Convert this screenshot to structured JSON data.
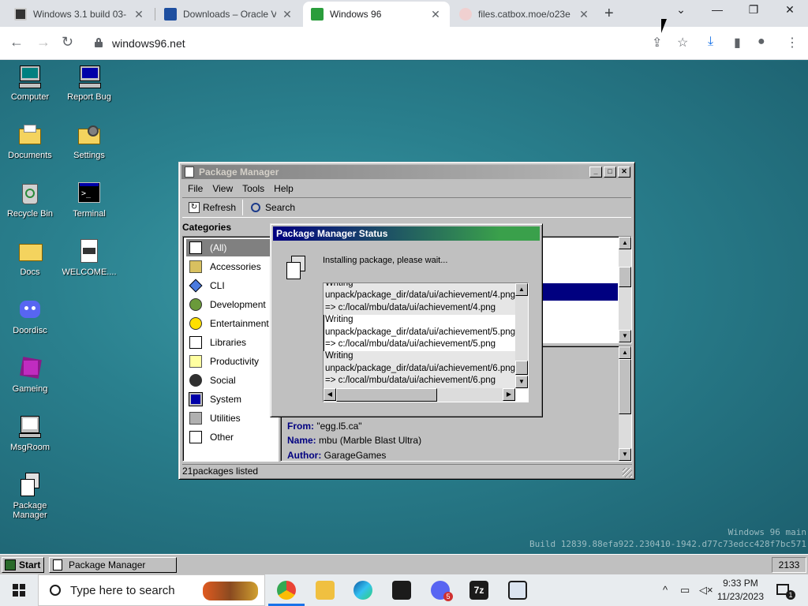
{
  "browser": {
    "tabs": [
      {
        "title": "Windows 3.1 build 03-",
        "active": false
      },
      {
        "title": "Downloads – Oracle V",
        "active": false
      },
      {
        "title": "Windows 96",
        "active": true
      },
      {
        "title": "files.catbox.moe/o23e",
        "active": false
      }
    ],
    "new_tab": "+",
    "url": "windows96.net"
  },
  "desktop": {
    "icons": [
      {
        "label": "Computer"
      },
      {
        "label": "Report Bug"
      },
      {
        "label": "Documents"
      },
      {
        "label": "Settings"
      },
      {
        "label": "Recycle Bin"
      },
      {
        "label": "Terminal"
      },
      {
        "label": "Docs"
      },
      {
        "label": "WELCOME...."
      },
      {
        "label": "Doordisc"
      },
      {
        "label": "Gameing"
      },
      {
        "label": "MsgRoom"
      },
      {
        "label": "Package Manager"
      }
    ],
    "watermark_line1": "Windows 96 main",
    "watermark_line2": "Build 12839.88efa922.230410-1942.d77c73edcc428f7bc571"
  },
  "package_manager": {
    "title": "Package Manager",
    "menu": [
      "File",
      "View",
      "Tools",
      "Help"
    ],
    "toolbar": {
      "refresh": "Refresh",
      "search": "Search"
    },
    "categories_heading": "Categories",
    "categories": [
      "(All)",
      "Accessories",
      "CLI",
      "Development",
      "Entertainment",
      "Libraries",
      "Productivity",
      "Social",
      "System",
      "Utilities",
      "Other"
    ],
    "selected_category": "(All)",
    "details": {
      "from_label": "From:",
      "from_value": "\"egg.l5.ca\"",
      "name_label": "Name:",
      "name_value": "mbu (Marble Blast Ultra)",
      "author_label": "Author:",
      "author_value": "GarageGames"
    },
    "status_bar": "21packages listed"
  },
  "status_dialog": {
    "title": "Package Manager Status",
    "message": "Installing package, please wait...",
    "log": [
      "Writing",
      "unpack/package_dir/data/ui/achievement/4.png",
      "=> c:/local/mbu/data/ui/achievement/4.png",
      "Writing",
      "unpack/package_dir/data/ui/achievement/5.png",
      "=> c:/local/mbu/data/ui/achievement/5.png",
      "Writing",
      "unpack/package_dir/data/ui/achievement/6.png",
      "=> c:/local/mbu/data/ui/achievement/6.png"
    ]
  },
  "w96_taskbar": {
    "start": "Start",
    "task": "Package Manager",
    "clock": "2133"
  },
  "win_taskbar": {
    "search_placeholder": "Type here to search",
    "discord_badge": "5",
    "time": "9:33 PM",
    "date": "11/23/2023",
    "notif_count": "1"
  },
  "colors": {
    "w96_title_active_start": "#000080",
    "w96_title_active_end": "#3aa04b",
    "w96_selected_row": "#000080",
    "w96_face": "#c0c0c0"
  }
}
